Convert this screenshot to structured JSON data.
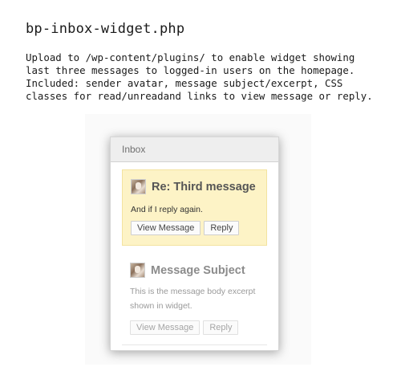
{
  "page": {
    "title": "bp-inbox-widget.php",
    "description": "Upload to /wp-content/plugins/ to enable widget showing\nlast three messages to logged-in users on the homepage.\nIncluded: sender avatar, message subject/excerpt, CSS\nclasses for read/unreadand links to view message or reply."
  },
  "widget": {
    "header": "Inbox",
    "messages": [
      {
        "state": "unread",
        "subject": "Re: Third message",
        "excerpt": "And if I reply again.",
        "view_label": "View Message",
        "reply_label": "Reply"
      },
      {
        "state": "read",
        "subject": "Message Subject",
        "excerpt": "This is the message body excerpt shown in widget.",
        "view_label": "View Message",
        "reply_label": "Reply"
      }
    ]
  },
  "colors": {
    "unread_background": "#fdf3c6",
    "header_background": "#eeeeee"
  }
}
